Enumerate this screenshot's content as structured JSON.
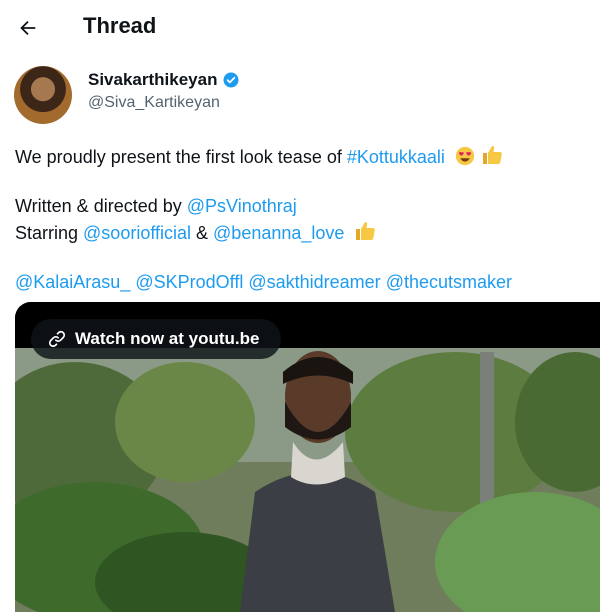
{
  "header": {
    "title": "Thread",
    "back_icon": "arrow-left-icon"
  },
  "author": {
    "name": "Sivakarthikeyan",
    "handle": "@Siva_Kartikeyan",
    "verified": true,
    "verified_color": "#1d9bf0"
  },
  "tweet": {
    "line1_prefix": "We proudly present the first look tease of ",
    "line1_hashtag": "#Kottukkaali",
    "line2_prefix": "Written & directed by ",
    "line2_mention": "@PsVinothraj",
    "line3_prefix": "Starring ",
    "line3_mention1": "@sooriofficial",
    "line3_mid": " & ",
    "line3_mention2": "@benanna_love",
    "mentions": [
      "@KalaiArasu_",
      "@SKProdOffl",
      "@sakthidreamer",
      "@thecutsmaker"
    ],
    "emojis": [
      "smiling-face-with-heart-eyes",
      "thumbs-up"
    ],
    "link_color": "#1d9bf0"
  },
  "media": {
    "watch_label": "Watch now at youtu.be",
    "link_icon": "link-icon"
  }
}
